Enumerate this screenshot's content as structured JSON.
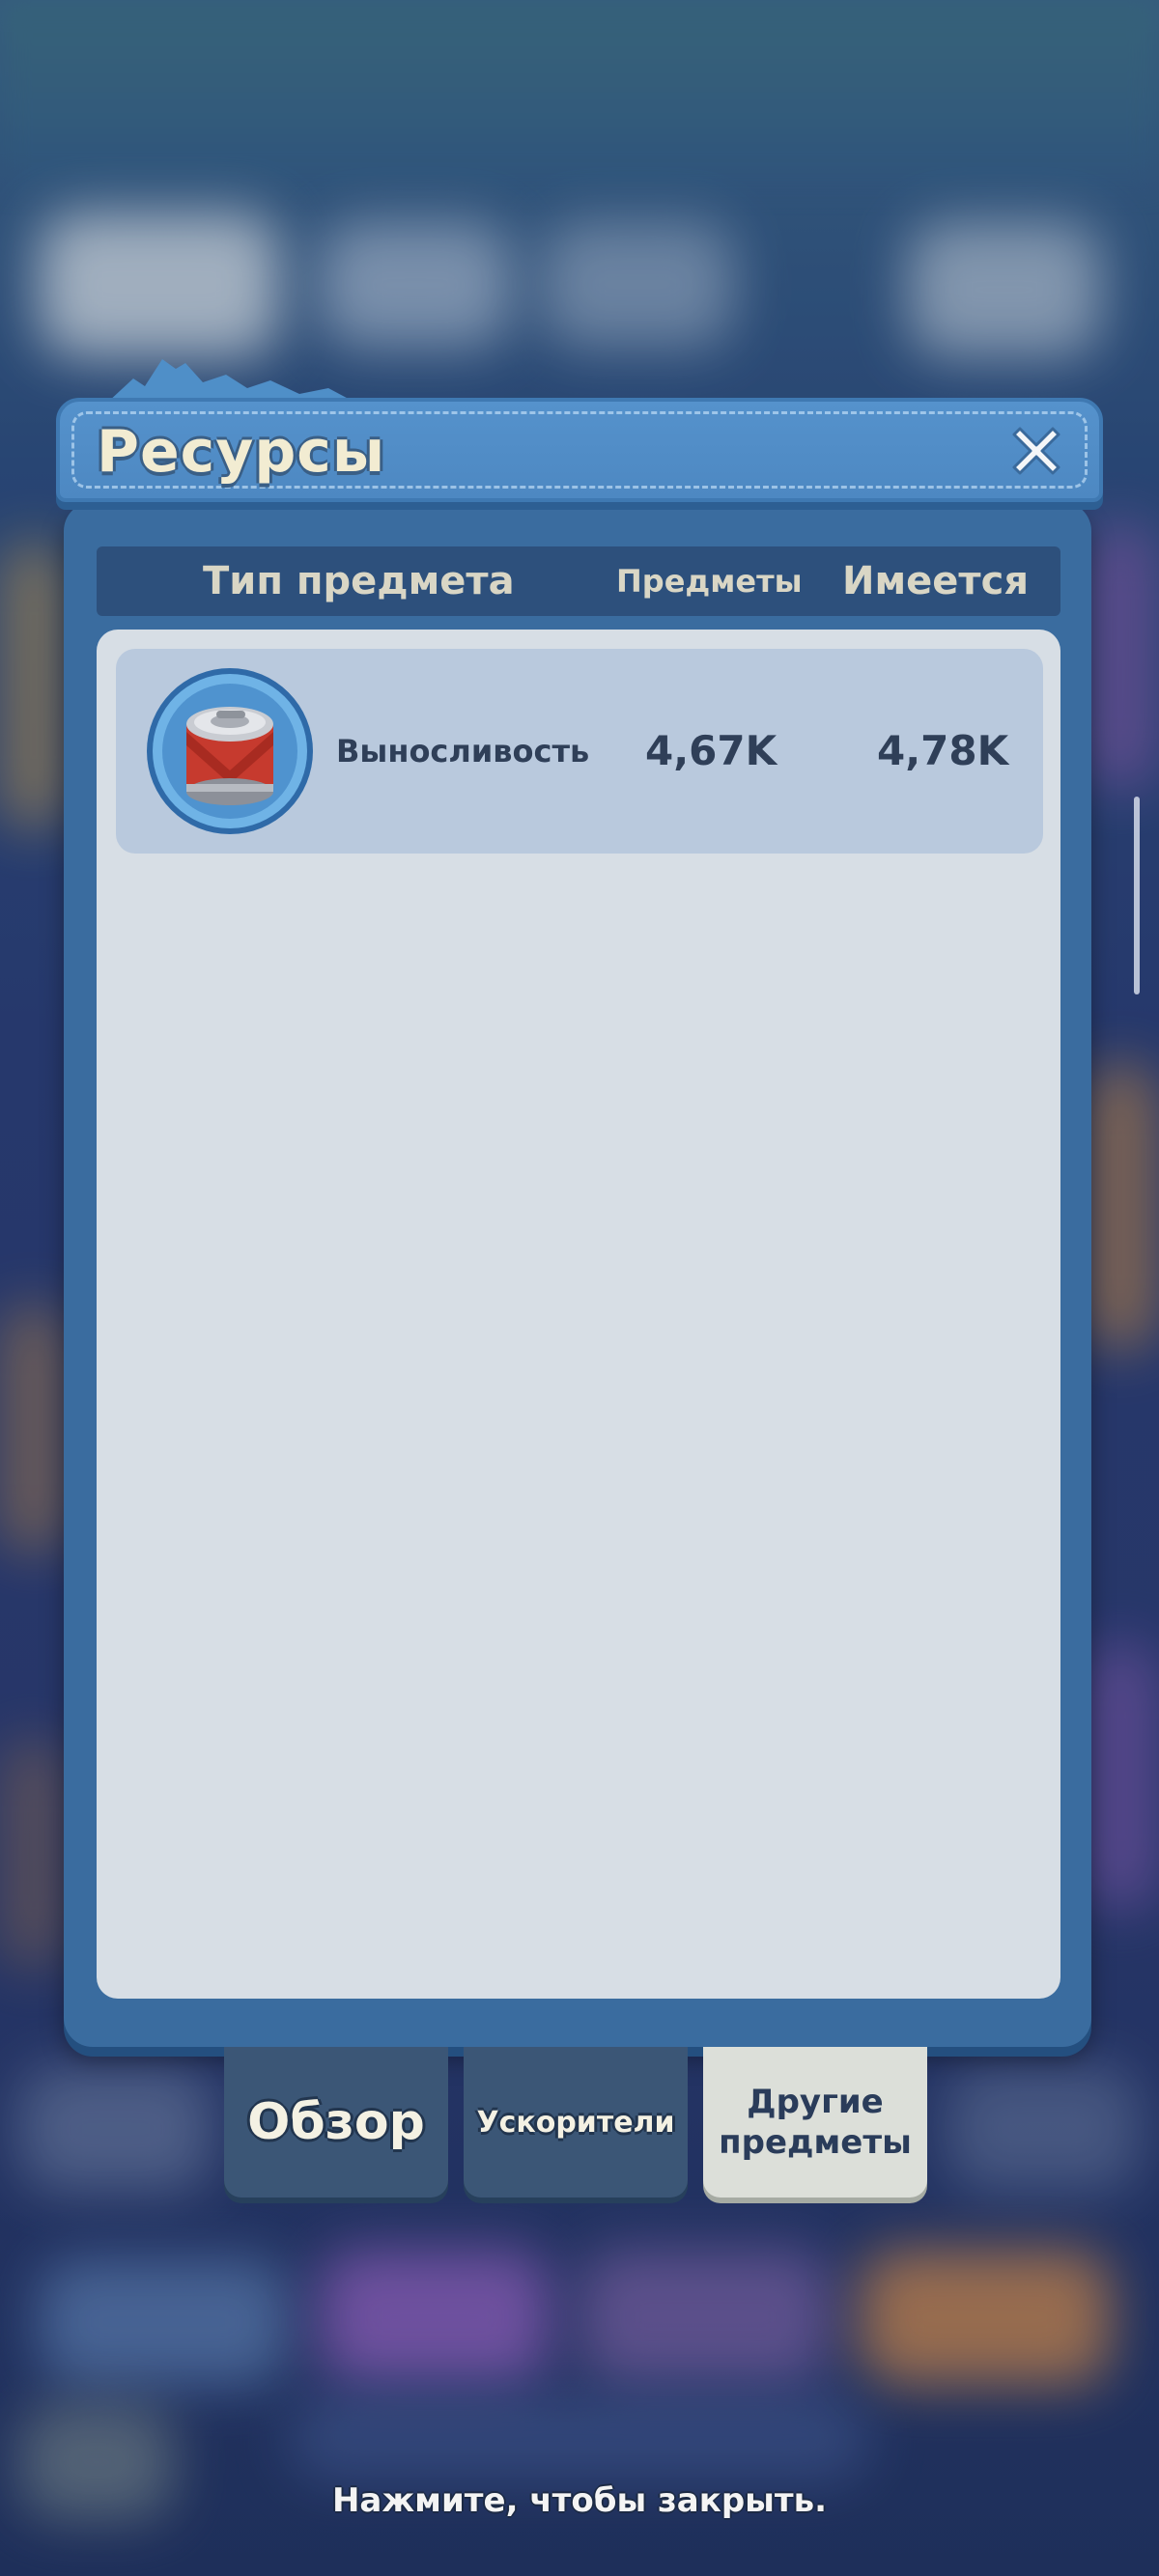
{
  "dialog": {
    "title": "Ресурсы",
    "close_icon": "close-icon"
  },
  "columns": {
    "type": "Тип предмета",
    "items": "Предметы",
    "have": "Имеется"
  },
  "rows": [
    {
      "icon": "stamina-can-icon",
      "name": "Выносливость",
      "items": "4,67K",
      "have": "4,78K"
    }
  ],
  "tabs": {
    "overview": "Обзор",
    "boosters": "Ускорители",
    "other_line1": "Другие",
    "other_line2": "предметы",
    "active": "other"
  },
  "hint": "Нажмите, чтобы закрыть.",
  "colors": {
    "dialog_frame": "#3a6c9f",
    "header": "#5592cc",
    "list_panel": "#d7dee5",
    "row": "#b9c9dd",
    "tab_inactive": "#3b5676",
    "tab_active": "#dcdfd9"
  }
}
